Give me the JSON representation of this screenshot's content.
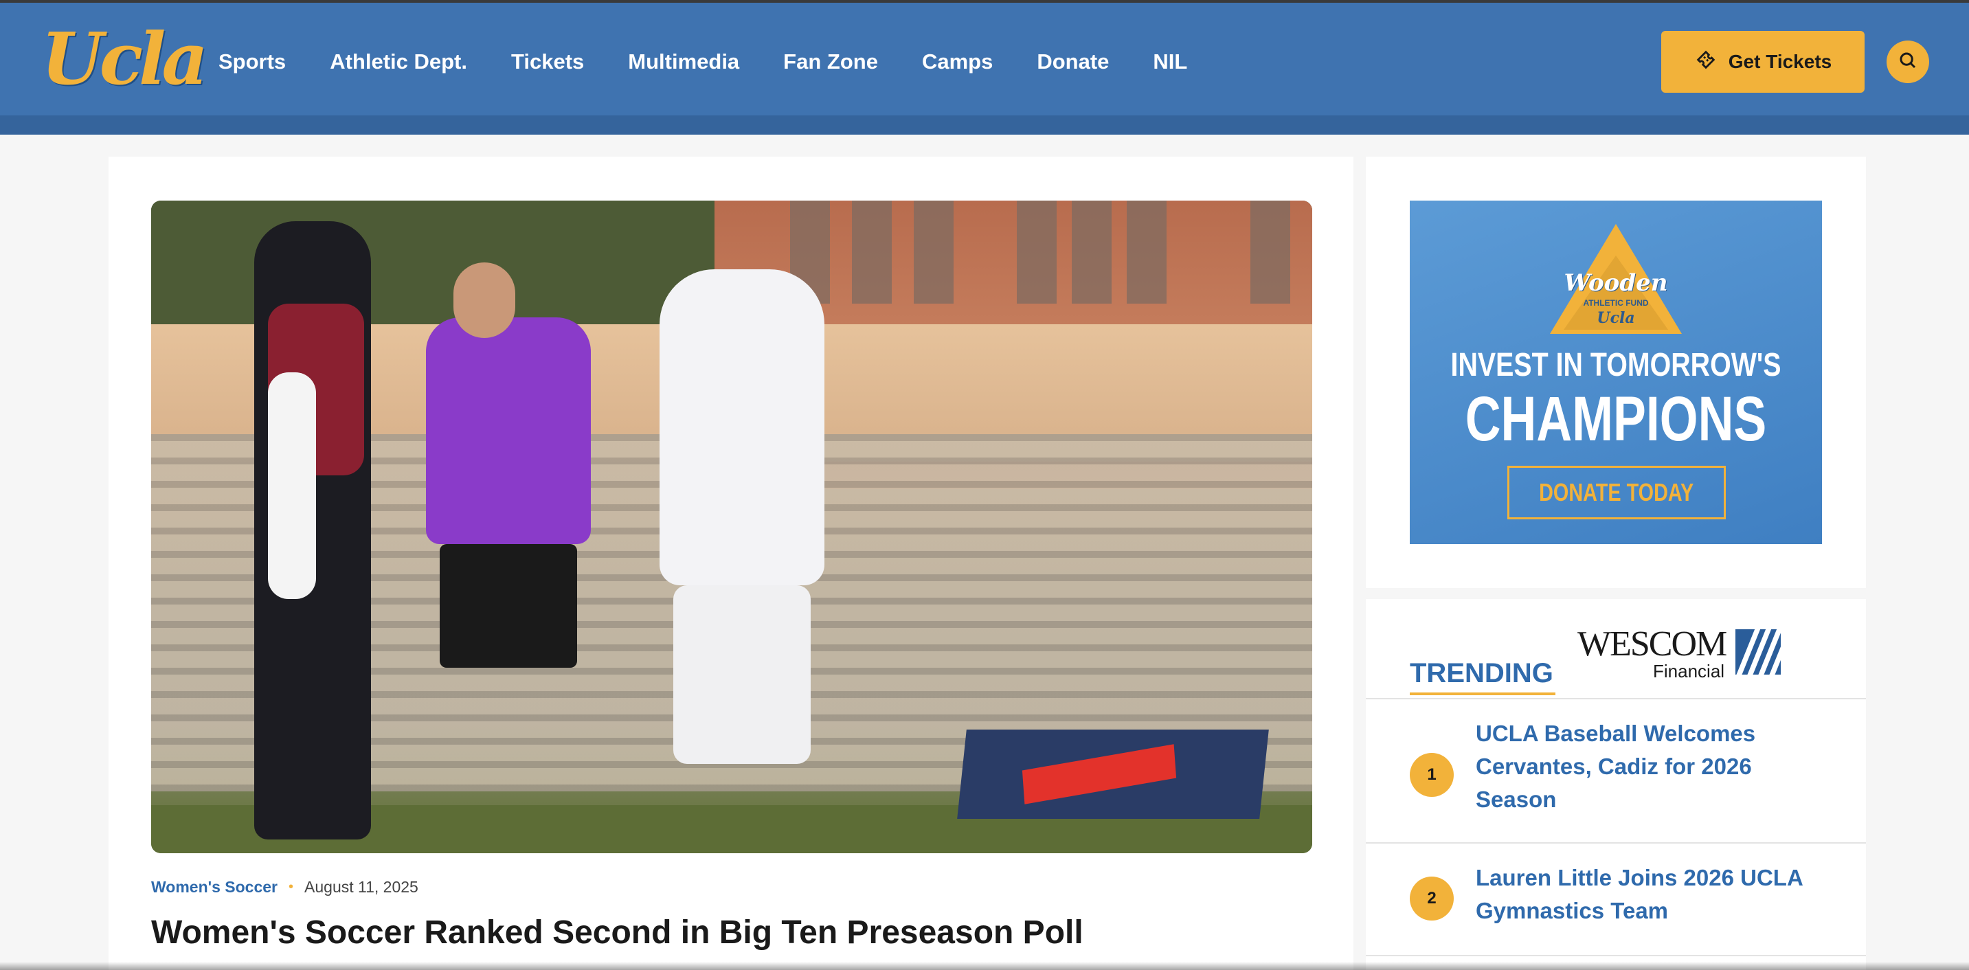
{
  "header": {
    "logo_text": "Ucla",
    "nav": [
      "Sports",
      "Athletic Dept.",
      "Tickets",
      "Multimedia",
      "Fan Zone",
      "Camps",
      "Donate",
      "NIL"
    ],
    "tickets_label": "Get Tickets",
    "accent_color": "#f2b23a",
    "bar_color": "#3f73b0"
  },
  "article": {
    "category": "Women's Soccer",
    "date": "August 11, 2025",
    "headline": "Women's Soccer Ranked Second in Big Ten Preseason Poll",
    "image_label": "UCLA women's soccer players celebrating"
  },
  "ad": {
    "brand": "Wooden",
    "fund": "ATHLETIC FUND",
    "school": "Ucla",
    "line1": "INVEST IN TOMORROW'S",
    "line2": "CHAMPIONS",
    "button": "DONATE TODAY"
  },
  "trending": {
    "title": "TRENDING",
    "sponsor_name": "WESCOM",
    "sponsor_sub": "Financial",
    "items": [
      {
        "num": "1",
        "title": "UCLA Baseball Welcomes Cervantes, Cadiz for 2026 Season"
      },
      {
        "num": "2",
        "title": "Lauren Little Joins 2026 UCLA Gymnastics Team"
      }
    ]
  }
}
